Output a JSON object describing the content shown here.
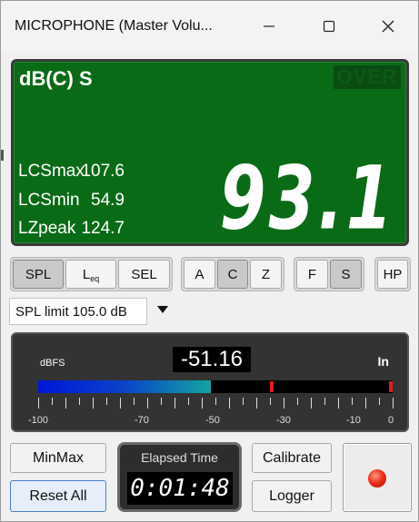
{
  "window": {
    "title": "MICROPHONE (Master Volu..."
  },
  "display": {
    "mode": "dB(C) S",
    "over": "OVER",
    "stats": [
      {
        "label": "LCSmax",
        "value": "107.6"
      },
      {
        "label": "LCSmin",
        "value": "54.9"
      },
      {
        "label": "LZpeak",
        "value": "124.7"
      }
    ],
    "level": "93.1"
  },
  "measure_group": {
    "spl": "SPL",
    "leq": "L",
    "leq_sub": "eq",
    "sel": "SEL"
  },
  "weighting_group": {
    "a": "A",
    "c": "C",
    "z": "Z"
  },
  "time_group": {
    "f": "F",
    "s": "S"
  },
  "hp_label": "HP",
  "spl_limit": {
    "value": "SPL limit 105.0 dB"
  },
  "meter": {
    "unit": "dBFS",
    "channel": "In",
    "reading": "-51.16",
    "level_dbfs": -51.16,
    "peaks_dbfs": [
      -34,
      -0.5
    ],
    "tick_labels": [
      "-100",
      "-70",
      "-50",
      "-30",
      "-10",
      "0"
    ]
  },
  "buttons": {
    "minmax": "MinMax",
    "reset_all": "Reset All",
    "calibrate": "Calibrate",
    "logger": "Logger"
  },
  "elapsed": {
    "title": "Elapsed Time",
    "time": "0:01:48"
  },
  "colors": {
    "display_green": "#0a6b17",
    "record_red": "#f0301a"
  }
}
